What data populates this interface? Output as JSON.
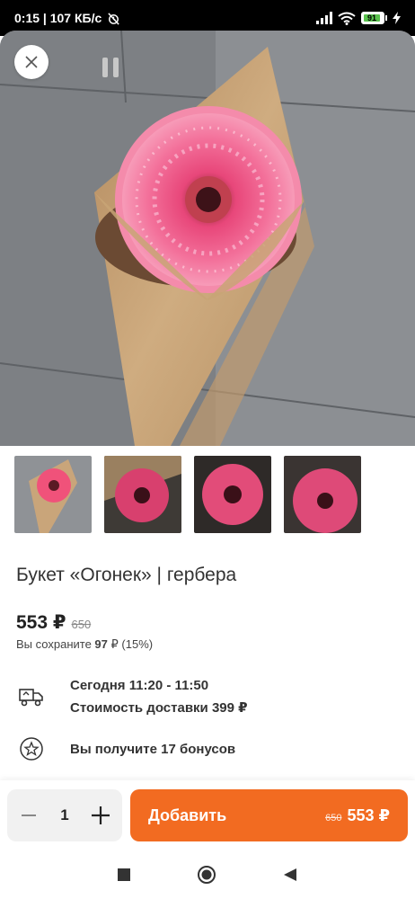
{
  "status_bar": {
    "time_info": "0:15 | 107 КБ/с",
    "battery_level": "91"
  },
  "product": {
    "title": "Букет «Огонек» | гербера",
    "price": "553 ₽",
    "old_price": "650",
    "save_prefix": "Вы сохраните",
    "save_amount": "97",
    "save_suffix": "₽ (15%)"
  },
  "delivery": {
    "time": "Сегодня 11:20 - 11:50",
    "cost": "Стоимость доставки 399 ₽",
    "icon": "delivery-truck-icon"
  },
  "bonus": {
    "text": "Вы получите 17 бонусов",
    "icon": "star-icon"
  },
  "cart": {
    "quantity": "1",
    "add_label": "Добавить",
    "add_old_price": "650",
    "add_price": "553 ₽"
  },
  "colors": {
    "accent": "#f26b21",
    "flower": "#f0527a",
    "paper": "#c8a47a"
  }
}
